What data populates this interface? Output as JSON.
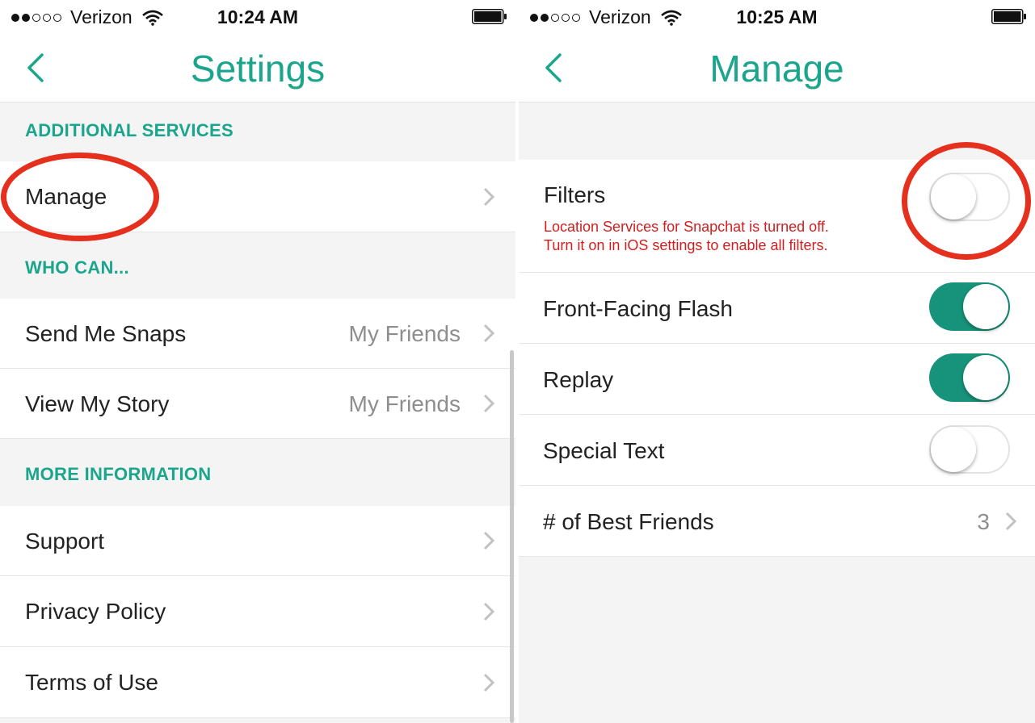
{
  "left": {
    "status": {
      "carrier": "Verizon",
      "time": "10:24 AM"
    },
    "nav": {
      "title": "Settings"
    },
    "sections": {
      "additional_services": "ADDITIONAL SERVICES",
      "who_can": "WHO CAN...",
      "more_information": "MORE INFORMATION"
    },
    "rows": {
      "manage": "Manage",
      "send_me_snaps": {
        "label": "Send Me Snaps",
        "value": "My Friends"
      },
      "view_my_story": {
        "label": "View My Story",
        "value": "My Friends"
      },
      "support": "Support",
      "privacy_policy": "Privacy Policy",
      "terms_of_use": "Terms of Use"
    }
  },
  "right": {
    "status": {
      "carrier": "Verizon",
      "time": "10:25 AM"
    },
    "nav": {
      "title": "Manage"
    },
    "filters": {
      "label": "Filters",
      "warning_line1": "Location Services for Snapchat is turned off.",
      "warning_line2": "Turn it on in iOS settings to enable all filters.",
      "enabled": false
    },
    "front_facing_flash": {
      "label": "Front-Facing Flash",
      "enabled": true
    },
    "replay": {
      "label": "Replay",
      "enabled": true
    },
    "special_text": {
      "label": "Special Text",
      "enabled": false
    },
    "best_friends": {
      "label": "# of Best Friends",
      "value": "3"
    }
  },
  "colors": {
    "accent": "#1aa58c",
    "toggle_on": "#16937a",
    "annotation": "#e5301d",
    "warning": "#d21e1e"
  },
  "icons": [
    "signal-dots-icon",
    "wifi-icon",
    "battery-icon",
    "back-chevron-icon",
    "chevron-right-icon"
  ]
}
